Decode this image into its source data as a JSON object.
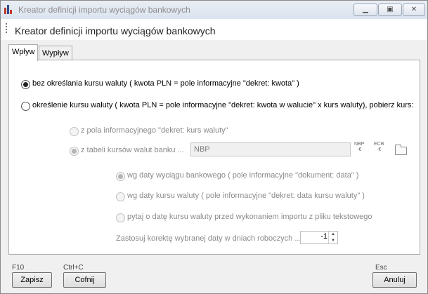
{
  "window": {
    "title": "Kreator definicji importu wyciągów bankowych"
  },
  "header": {
    "title": "Kreator definicji importu wyciągów bankowych"
  },
  "tabs": [
    {
      "label": "Wpływ"
    },
    {
      "label": "Wypływ"
    }
  ],
  "options": {
    "no_rate": "bez określania kursu waluty ( kwota PLN = pole informacyjne \"dekret: kwota\" )",
    "with_rate": "określenie kursu waluty ( kwota PLN = pole informacyjne \"dekret: kwota w walucie\" x kurs waluty), pobierz kurs:",
    "from_field": "z pola informacyjnego \"dekret: kurs waluty\"",
    "from_table": "z tabeli kursów walut banku ...",
    "bank_value": "NBP",
    "nbp_icon": "NBP",
    "ecb_icon": "ECB",
    "by_statement_date": "wg daty wyciągu bankowego ( pole informacyjne \"dokument: data\" )",
    "by_rate_date": "wg daty kursu waluty ( pole informacyjne \"dekret: data kursu waluty\" )",
    "ask_date": "pytaj o datę kursu waluty przed wykonaniem importu z pliku tekstowego",
    "correction_label": "Zastosuj korektę wybranej daty w dniach roboczych ...",
    "correction_value": "-1"
  },
  "footer": {
    "save_key": "F10",
    "save_label": "Zapisz",
    "undo_key": "Ctrl+C",
    "undo_label": "Cofnij",
    "cancel_key": "Esc",
    "cancel_label": "Anuluj"
  },
  "colors": {
    "accent": "#c0392b",
    "window_bg": "#f0f0f0",
    "disabled_text": "#8a8a8a"
  },
  "icons": [
    "app-icon",
    "minimize-icon",
    "maximize-icon",
    "close-icon",
    "grip-icon",
    "nbp-rate-icon",
    "ecb-rate-icon",
    "folder-icon",
    "spin-up-icon",
    "spin-down-icon"
  ]
}
